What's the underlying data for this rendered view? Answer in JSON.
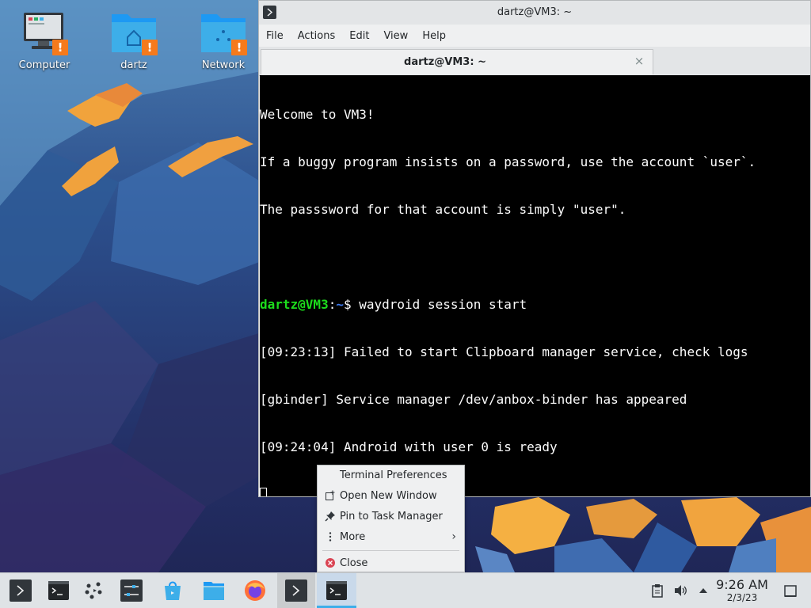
{
  "desktop": {
    "icons": [
      {
        "label": "Computer",
        "badge": "!"
      },
      {
        "label": "dartz",
        "badge": "!"
      },
      {
        "label": "Network",
        "badge": "!"
      }
    ]
  },
  "terminal": {
    "window_title": "dartz@VM3: ~",
    "menu": [
      "File",
      "Actions",
      "Edit",
      "View",
      "Help"
    ],
    "tab_title": "dartz@VM3: ~",
    "tab_close": "×",
    "lines": [
      "Welcome to VM3!",
      "If a buggy program insists on a password, use the account `user`.",
      "The passsword for that account is simply \"user\".",
      "",
      "",
      "[09:23:13] Failed to start Clipboard manager service, check logs",
      "[gbinder] Service manager /dev/anbox-binder has appeared",
      "[09:24:04] Android with user 0 is ready"
    ],
    "prompt_user": "dartz@VM3",
    "prompt_sep": ":",
    "prompt_path": "~",
    "prompt_symbol": "$ ",
    "command": "waydroid session start"
  },
  "context_menu": {
    "items": [
      {
        "label": "Terminal Preferences",
        "icon": "none"
      },
      {
        "label": "Open New Window",
        "icon": "new-window-icon"
      },
      {
        "label": "Pin to Task Manager",
        "icon": "pin-icon"
      },
      {
        "label": "More",
        "icon": "more-vertical-icon"
      },
      {
        "label": "Close",
        "icon": "close-circle-icon"
      }
    ],
    "more_arrow": "›"
  },
  "taskbar": {
    "apps": [
      "konsole-launcher-icon",
      "terminal-icon",
      "kdeconnect-icon",
      "system-settings-icon",
      "discover-store-icon",
      "file-manager-icon",
      "firefox-icon",
      "konsole-icon",
      "terminal-window-icon"
    ],
    "clock_time": "9:26 AM",
    "clock_date": "2/3/23"
  },
  "colors": {
    "accent": "#3daee9",
    "prompt_user": "#1cdc1c",
    "prompt_path": "#3d7cf4",
    "warning_badge": "#f57a1c",
    "close_icon": "#da4453"
  }
}
